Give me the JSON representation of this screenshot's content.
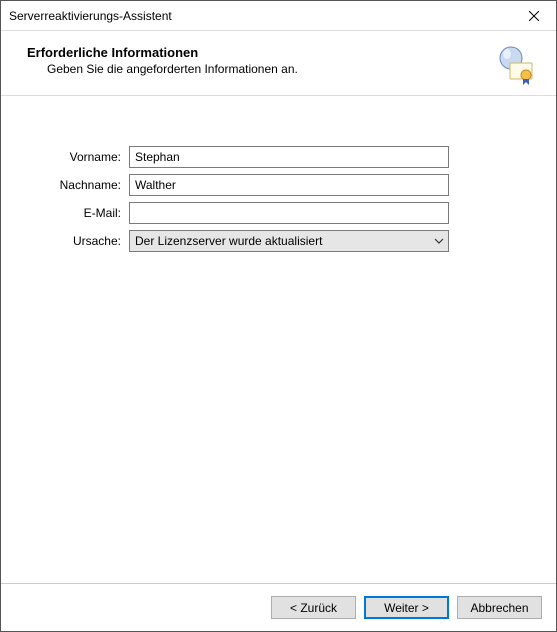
{
  "window": {
    "title": "Serverreaktivierungs-Assistent"
  },
  "header": {
    "title": "Erforderliche Informationen",
    "subtitle": "Geben Sie die angeforderten Informationen an."
  },
  "form": {
    "vorname": {
      "label": "Vorname:",
      "value": "Stephan"
    },
    "nachname": {
      "label": "Nachname:",
      "value": "Walther"
    },
    "email": {
      "label": "E-Mail:",
      "value": ""
    },
    "ursache": {
      "label": "Ursache:",
      "selected": "Der Lizenzserver wurde aktualisiert"
    }
  },
  "footer": {
    "back": "< Zurück",
    "next": "Weiter >",
    "cancel": "Abbrechen"
  }
}
